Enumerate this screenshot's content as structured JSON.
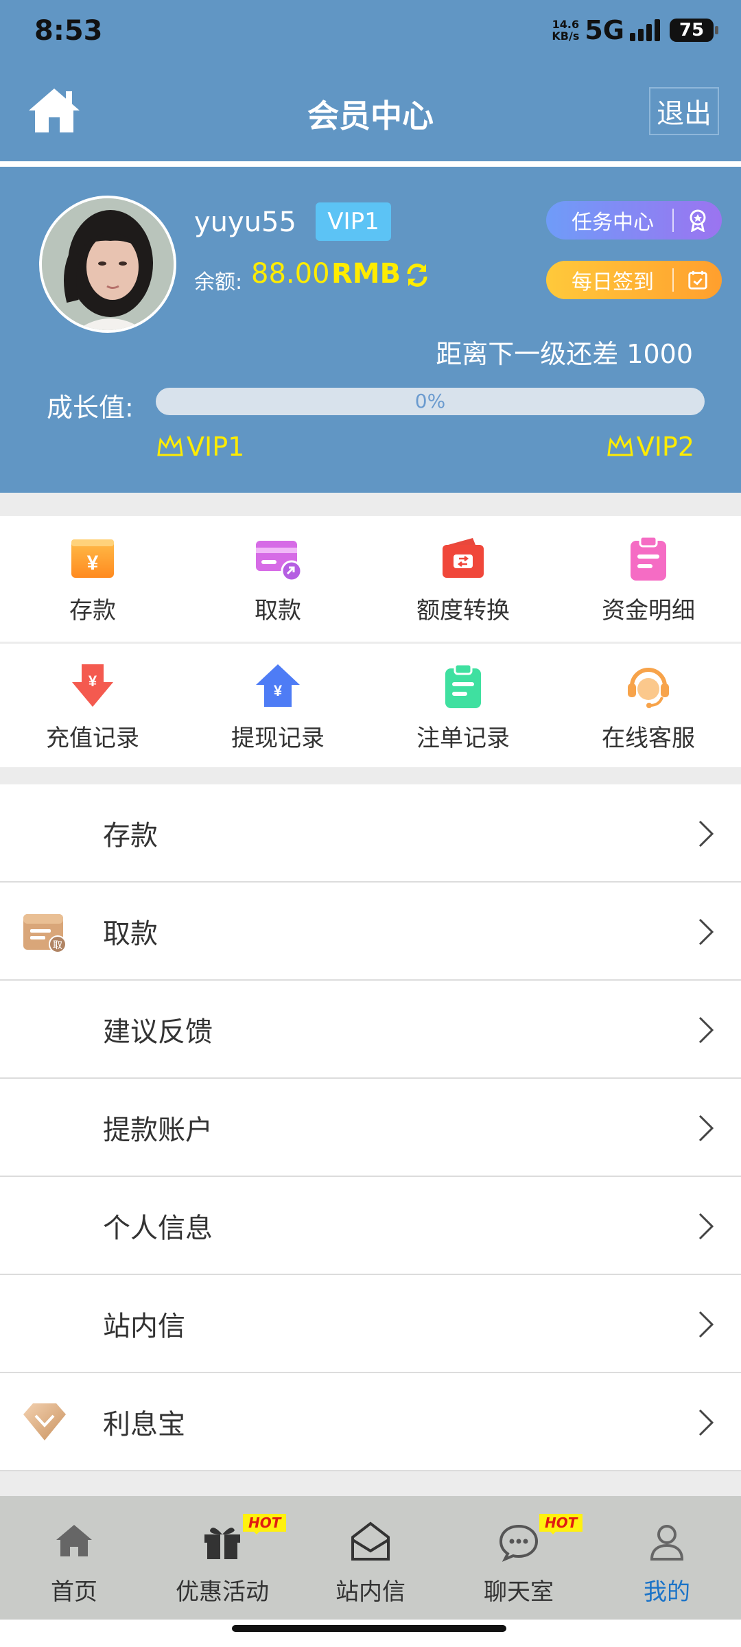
{
  "status_bar": {
    "time": "8:53",
    "net_speed_top": "14.6",
    "net_speed_bottom": "KB/s",
    "network": "5G",
    "battery": "75"
  },
  "header": {
    "title": "会员中心",
    "logout_label": "退出"
  },
  "profile": {
    "username": "yuyu55",
    "vip_level": "VIP1",
    "balance_label": "余额:",
    "balance_amount": "88.00",
    "balance_unit": "RMB",
    "task_center_label": "任务中心",
    "daily_checkin_label": "每日签到",
    "next_level_text": "距离下一级还差  1000",
    "growth_label": "成长值:",
    "progress": 0,
    "progress_text": "0%",
    "current_vip": "VIP1",
    "next_vip": "VIP2"
  },
  "grid": {
    "row1": [
      {
        "label": "存款",
        "icon": "deposit-icon"
      },
      {
        "label": "取款",
        "icon": "withdraw-card-icon"
      },
      {
        "label": "额度转换",
        "icon": "transfer-wallet-icon"
      },
      {
        "label": "资金明细",
        "icon": "clipboard-icon"
      }
    ],
    "row2": [
      {
        "label": "充值记录",
        "icon": "recharge-record-icon"
      },
      {
        "label": "提现记录",
        "icon": "withdraw-record-icon"
      },
      {
        "label": "注单记录",
        "icon": "bet-record-icon"
      },
      {
        "label": "在线客服",
        "icon": "customer-service-icon"
      }
    ]
  },
  "list": [
    {
      "label": "存款"
    },
    {
      "label": "取款",
      "icon_text": "取"
    },
    {
      "label": "建议反馈"
    },
    {
      "label": "提款账户"
    },
    {
      "label": "个人信息"
    },
    {
      "label": "站内信"
    },
    {
      "label": "利息宝"
    }
  ],
  "tabbar": [
    {
      "label": "首页",
      "icon": "home-icon"
    },
    {
      "label": "优惠活动",
      "icon": "gift-icon",
      "badge": "HOT"
    },
    {
      "label": "站内信",
      "icon": "mail-icon"
    },
    {
      "label": "聊天室",
      "icon": "chat-icon",
      "badge": "HOT"
    },
    {
      "label": "我的",
      "icon": "user-icon",
      "active": true
    }
  ],
  "colors": {
    "header_bg": "#6196c4",
    "balance": "#ffec00",
    "active_tab": "#1a73c8"
  }
}
